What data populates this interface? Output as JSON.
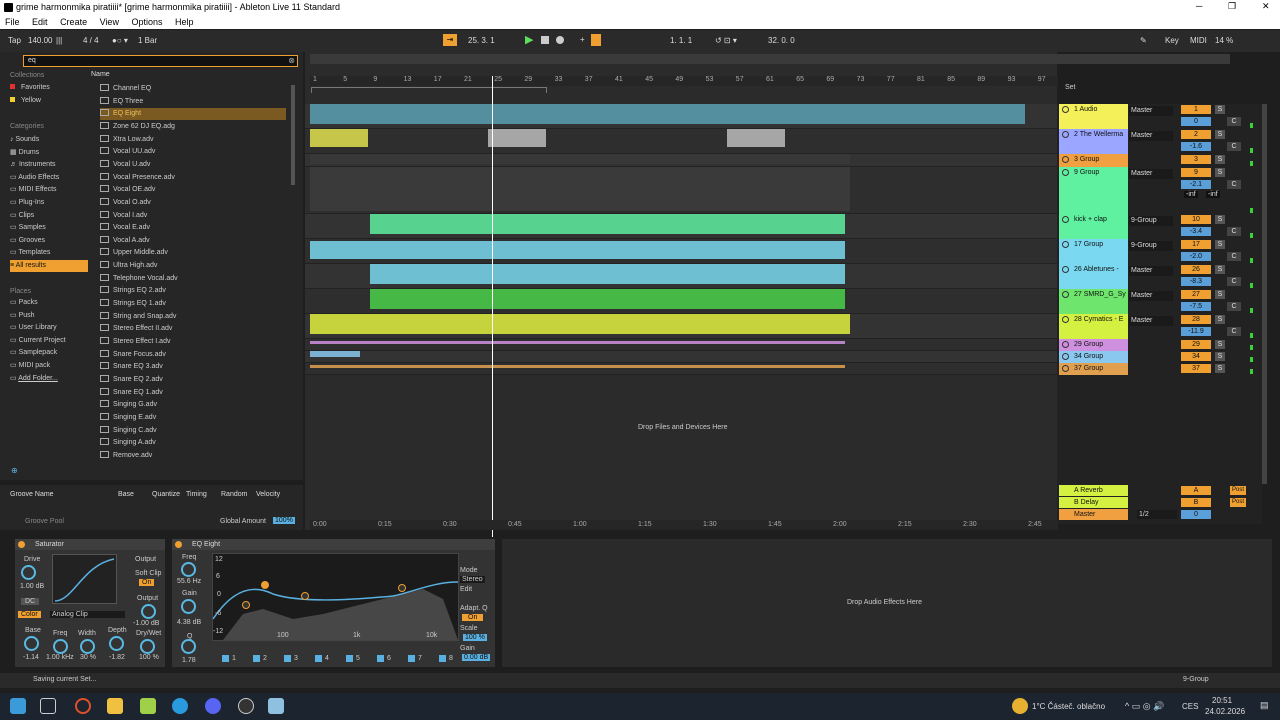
{
  "window": {
    "title": "grime harmonmika piratiiii* [grime harmonmika piratiiii] - Ableton Live 11 Standard"
  },
  "menu": [
    "File",
    "Edit",
    "Create",
    "View",
    "Options",
    "Help"
  ],
  "control": {
    "tap": "Tap",
    "tempo": "140.00",
    "sig": "4 / 4",
    "quant": "1 Bar",
    "position": "25.  3.  1",
    "loop_start": "1.  1.  1",
    "loop_len": "32.  0.  0",
    "key": "Key",
    "midi": "MIDI",
    "cpu": "14 %"
  },
  "browser": {
    "search": "eq",
    "collections_head": "Collections",
    "collections": [
      "Favorites",
      "Yellow"
    ],
    "categories_head": "Categories",
    "categories": [
      "Sounds",
      "Drums",
      "Instruments",
      "Audio Effects",
      "MIDI Effects",
      "Plug-Ins",
      "Clips",
      "Samples",
      "Grooves",
      "Templates",
      "All results"
    ],
    "places_head": "Places",
    "places": [
      "Packs",
      "Push",
      "User Library",
      "Current Project",
      "Samplepack",
      "MIDI pack",
      "Add Folder..."
    ],
    "name_head": "Name",
    "files": [
      "Channel EQ",
      "EQ Three",
      "EQ Eight",
      "Zone 62 DJ EQ.adg",
      "Xtra Low.adv",
      "Vocal UU.adv",
      "Vocal U.adv",
      "Vocal Presence.adv",
      "Vocal OE.adv",
      "Vocal O.adv",
      "Vocal I.adv",
      "Vocal E.adv",
      "Vocal A.adv",
      "Upper Middle.adv",
      "Ultra High.adv",
      "Telephone Vocal.adv",
      "Strings EQ 2.adv",
      "Strings EQ 1.adv",
      "String and Snap.adv",
      "Stereo Effect II.adv",
      "Stereo Effect I.adv",
      "Snare Focus.adv",
      "Snare EQ 3.adv",
      "Snare EQ 2.adv",
      "Snare EQ 1.adv",
      "Singing G.adv",
      "Singing E.adv",
      "Singing C.adv",
      "Singing A.adv",
      "Remove.adv"
    ]
  },
  "groove": {
    "cols": [
      "Groove Name",
      "Base",
      "Quantize",
      "Timing",
      "Random",
      "Velocity"
    ],
    "pool": "Groove Pool",
    "amount_label": "Global Amount",
    "amount": "100%"
  },
  "ruler": [
    "1",
    "5",
    "9",
    "13",
    "17",
    "21",
    "25",
    "29",
    "33",
    "37",
    "41",
    "45",
    "49",
    "53",
    "57",
    "61",
    "65",
    "69",
    "73",
    "77",
    "81",
    "85",
    "89",
    "93",
    "97"
  ],
  "time_ruler": [
    "0:00",
    "0:15",
    "0:30",
    "0:45",
    "1:00",
    "1:15",
    "1:30",
    "1:45",
    "2:00",
    "2:15",
    "2:30",
    "2:45"
  ],
  "set_label": "Set",
  "drop_files": "Drop Files and Devices Here",
  "tracks": [
    {
      "name": "1 Audio",
      "color": "#f4f05a",
      "out": "Master",
      "num": "1",
      "vol": "0"
    },
    {
      "name": "2 The Wellerma",
      "color": "#9aa6ff",
      "out": "Master",
      "num": "2",
      "vol": "-1.6"
    },
    {
      "name": "3 Group",
      "color": "#f0a040",
      "out": "",
      "num": "3",
      "vol": ""
    },
    {
      "name": "9 Group",
      "color": "#5ff0a0",
      "out": "Master",
      "num": "9",
      "vol": "-2.1"
    },
    {
      "name": "kick + clap",
      "color": "#5ff0a0",
      "out": "9-Group",
      "num": "10",
      "vol": "-3.4"
    },
    {
      "name": "17 Group",
      "color": "#7ad8f0",
      "out": "9-Group",
      "num": "17",
      "vol": "-2.0"
    },
    {
      "name": "26 Abletunes -",
      "color": "#7ad8f0",
      "out": "Master",
      "num": "26",
      "vol": "-8.3"
    },
    {
      "name": "27 SMRD_G_Sy",
      "color": "#6ee66e",
      "out": "Master",
      "num": "27",
      "vol": "-7.5"
    },
    {
      "name": "28 Cymatics - E",
      "color": "#d4f040",
      "out": "Master",
      "num": "28",
      "vol": "-11.9"
    },
    {
      "name": "29 Group",
      "color": "#d090e0",
      "out": "",
      "num": "29",
      "vol": ""
    },
    {
      "name": "34 Group",
      "color": "#8ac8f0",
      "out": "",
      "num": "34",
      "vol": ""
    },
    {
      "name": "37 Group",
      "color": "#e0a050",
      "out": "",
      "num": "37",
      "vol": ""
    }
  ],
  "returns": [
    {
      "name": "A Reverb",
      "color": "#d4f040",
      "num": "A",
      "post": "Post"
    },
    {
      "name": "B Delay",
      "color": "#d4f040",
      "num": "B",
      "post": "Post"
    },
    {
      "name": "Master",
      "color": "#f0a040",
      "num": "0",
      "out": "1/2"
    }
  ],
  "inf": [
    "-inf",
    "-inf"
  ],
  "saturator": {
    "title": "Saturator",
    "drive": "Drive",
    "drive_val": "1.00 dB",
    "dc": "DC",
    "color": "Color",
    "type": "Analog Clip",
    "output": "Output",
    "soft_clip": "Soft Clip",
    "on": "On",
    "output_lbl": "Output",
    "out_val": "-1.00 dB",
    "base": "Base",
    "base_val": "-1.14",
    "freq": "Freq",
    "freq_val": "1.00 kHz",
    "width": "Width",
    "width_val": "30 %",
    "depth": "Depth",
    "depth_val": "-1.82",
    "drywet": "Dry/Wet",
    "drywet_val": "100 %"
  },
  "eq": {
    "title": "EQ Eight",
    "freq": "Freq",
    "freq_val": "55.6 Hz",
    "gain": "Gain",
    "gain_val": "4.38 dB",
    "q": "Q",
    "q_val": "1.78",
    "ticks": [
      "12",
      "6",
      "0",
      "-6",
      "-12"
    ],
    "fticks": [
      "100",
      "1k",
      "10k"
    ],
    "mode": "Mode",
    "stereo": "Stereo",
    "edit": "Edit",
    "adapt": "Adapt. Q",
    "on": "On",
    "scale": "Scale",
    "scale_val": "100 %",
    "gain2": "Gain",
    "gain2_val": "0.00 dB",
    "bands": [
      "1",
      "2",
      "3",
      "4",
      "5",
      "6",
      "7",
      "8"
    ]
  },
  "drop_audio": "Drop Audio Effects Here",
  "status": {
    "text": "Saving current Set...",
    "track": "9-Group"
  },
  "taskbar": {
    "weather": "1°C  Částeč. oblačno",
    "lang": "CES",
    "time": "20:51",
    "date": "24.02.2026"
  }
}
